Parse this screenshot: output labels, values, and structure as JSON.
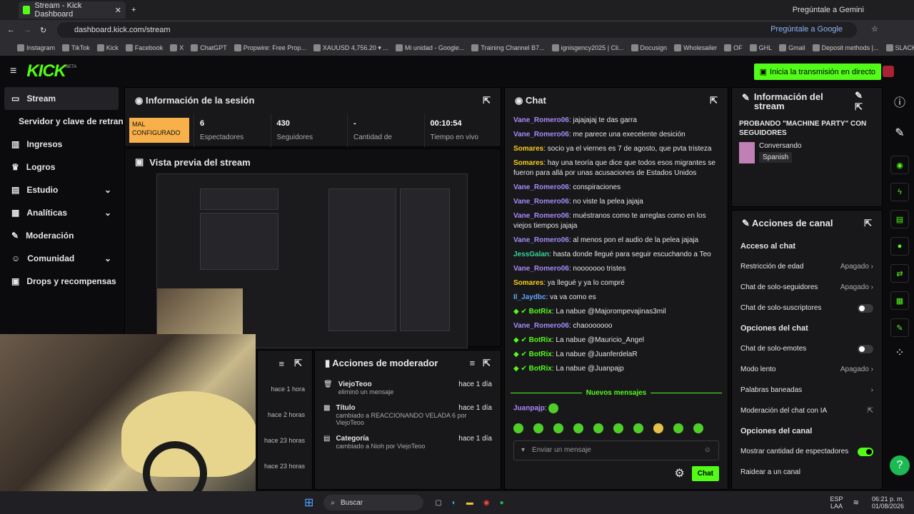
{
  "browser": {
    "tab_title": "Stream - Kick Dashboard",
    "url": "dashboard.kick.com/stream",
    "gemini": "Pregúntale a Gemini",
    "google": "Pregúntale a Google"
  },
  "bookmarks": [
    "Instagram",
    "TikTok",
    "Kick",
    "Facebook",
    "X",
    "ChatGPT",
    "Propwire: Free Prop...",
    "XAUUSD 4,756.20 ▾ ...",
    "Mi unidad - Google...",
    "Training Channel B7...",
    "ignisgency2025 | Cli...",
    "Docusign",
    "Wholesailer",
    "OF",
    "GHL",
    "Gmail",
    "Deposit methods |...",
    "SLACK"
  ],
  "topbar": {
    "logo": "KICK",
    "beta": "BETA",
    "go_live": "Inicia la transmisión en directo"
  },
  "sidebar": [
    "Stream",
    "Servidor y clave de retransmisión",
    "Ingresos",
    "Logros",
    "Estudio",
    "Analíticas",
    "Moderación",
    "Comunidad",
    "Drops y recompensas"
  ],
  "session": {
    "title": "Información de la sesión",
    "badge": "MAL CONFIGURADO",
    "stats": [
      {
        "v": "6",
        "l": "Espectadores"
      },
      {
        "v": "430",
        "l": "Seguidores"
      },
      {
        "v": "-",
        "l": "Cantidad de"
      },
      {
        "v": "00:10:54",
        "l": "Tiempo en vivo"
      }
    ]
  },
  "preview": {
    "title": "Vista previa del stream"
  },
  "chat": {
    "title": "Chat",
    "lines": [
      {
        "u": "Vane_Romero06",
        "c": "#a78bfa",
        "t": "jajajajaj te das garra"
      },
      {
        "u": "Vane_Romero06",
        "c": "#a78bfa",
        "t": "me parece una execelente desición"
      },
      {
        "u": "Somares",
        "c": "#facc15",
        "t": "socio ya el viernes es 7 de agosto, que pvta tristeza"
      },
      {
        "u": "Somares",
        "c": "#facc15",
        "t": "hay una teoría que dice que todos esos migrantes se fueron para allá por unas acusaciones de Estados Unidos"
      },
      {
        "u": "Vane_Romero06",
        "c": "#a78bfa",
        "t": "conspiraciones"
      },
      {
        "u": "Vane_Romero06",
        "c": "#a78bfa",
        "t": "no viste la pelea jajaja"
      },
      {
        "u": "Vane_Romero06",
        "c": "#a78bfa",
        "t": "muéstranos como te arreglas como en los viejos tiempos jajaja"
      },
      {
        "u": "Vane_Romero06",
        "c": "#a78bfa",
        "t": "al menos pon el audio de la pelea jajaja"
      },
      {
        "u": "JessGalan",
        "c": "#34d399",
        "t": "hasta donde llegué para seguir escuchando a Teo"
      },
      {
        "u": "Vane_Romero06",
        "c": "#a78bfa",
        "t": "nooooooo tristes"
      },
      {
        "u": "Somares",
        "c": "#facc15",
        "t": "ya llegué y ya lo compré"
      },
      {
        "u": "Il_Jaydbc",
        "c": "#60a5fa",
        "t": "va va como es"
      },
      {
        "u": "BotRix",
        "c": "#53fc18",
        "t": "La nabue @Majorompevajinas3mil"
      },
      {
        "u": "Vane_Romero06",
        "c": "#a78bfa",
        "t": "chaooooooo"
      },
      {
        "u": "BotRix",
        "c": "#53fc18",
        "t": "La nabue @Mauricio_Angel"
      },
      {
        "u": "BotRix",
        "c": "#53fc18",
        "t": "La nabue @JuanferdelaR"
      },
      {
        "u": "BotRix",
        "c": "#53fc18",
        "t": "La nabue @Juanpajp"
      }
    ],
    "new_msgs": "Nuevos mensajes",
    "last_user": "Juanpajp",
    "placeholder": "Enviar un mensaje",
    "send": "Chat"
  },
  "stream_info": {
    "title": "Información del stream",
    "stream_title": "PROBANDO \"MACHINE PARTY\" CON SEGUIDORES",
    "category": "Conversando",
    "lang": "Spanish"
  },
  "channel": {
    "title": "Acciones de canal",
    "chat_access": "Acceso al chat",
    "age": "Restricción de edad",
    "age_v": "Apagado",
    "followers": "Chat de solo-seguidores",
    "followers_v": "Apagado",
    "subs": "Chat de solo-suscriptores",
    "chat_opts": "Opciones del chat",
    "emotes": "Chat de solo-emotes",
    "slow": "Modo lento",
    "slow_v": "Apagado",
    "banned": "Palabras baneadas",
    "ai": "Moderación del chat con IA",
    "channel_opts": "Opciones del canal",
    "show_viewers": "Mostrar cantidad de espectadores",
    "raid": "Raidear a un canal"
  },
  "mod": {
    "title": "Acciones de moderador",
    "times": [
      "hace 1 hora",
      "hace 2 horas",
      "hace 23 horas",
      "hace 23 horas"
    ],
    "items": [
      {
        "name": "ViejoTeoo",
        "time": "hace 1 día",
        "desc": "eliminó un mensaje"
      },
      {
        "name": "Título",
        "time": "hace 1 día",
        "desc": "cambiado a REACCIONANDO VELADA 6 por ViejoTeoo"
      },
      {
        "name": "Categoría",
        "time": "hace 1 día",
        "desc": "cambiado a Nioh por ViejoTeoo"
      }
    ]
  },
  "taskbar": {
    "search": "Buscar",
    "lang": "ESP",
    "lang2": "LAA",
    "time": "06:21 p. m.",
    "date": "01/08/2026"
  }
}
